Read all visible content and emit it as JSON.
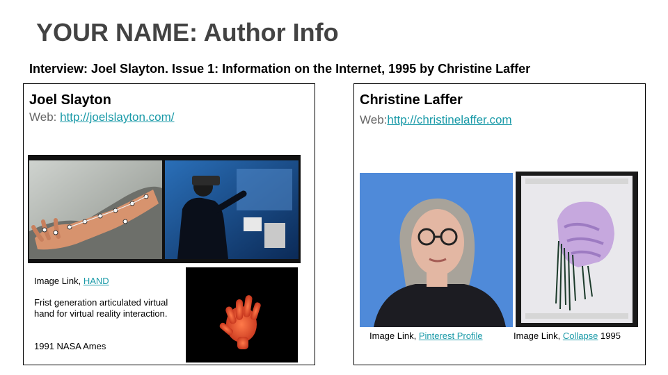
{
  "page": {
    "title": "YOUR NAME: Author Info",
    "subtitle": "Interview: Joel Slayton.  Issue 1: Information on the Internet, 1995 by Christine Laffer"
  },
  "left_card": {
    "name": "Joel Slayton",
    "web_label": "Web: ",
    "web_url": "http://joelslayton.com/",
    "caption_prefix": "Image Link, ",
    "caption_link": "HAND",
    "description": "Frist generation articulated virtual hand for virtual reality interaction.",
    "credit": "1991 NASA Ames"
  },
  "right_card": {
    "name": "Christine Laffer",
    "web_label": "Web:",
    "web_url": "http://christinelaffer.com",
    "caption1_prefix": "Image Link, ",
    "caption1_link": "Pinterest Profile",
    "caption2_prefix": "Image Link, ",
    "caption2_link": "Collapse",
    "caption2_suffix": " 1995"
  },
  "colors": {
    "title": "#434343",
    "link": "#1a9aa8",
    "web_label": "#666666"
  }
}
